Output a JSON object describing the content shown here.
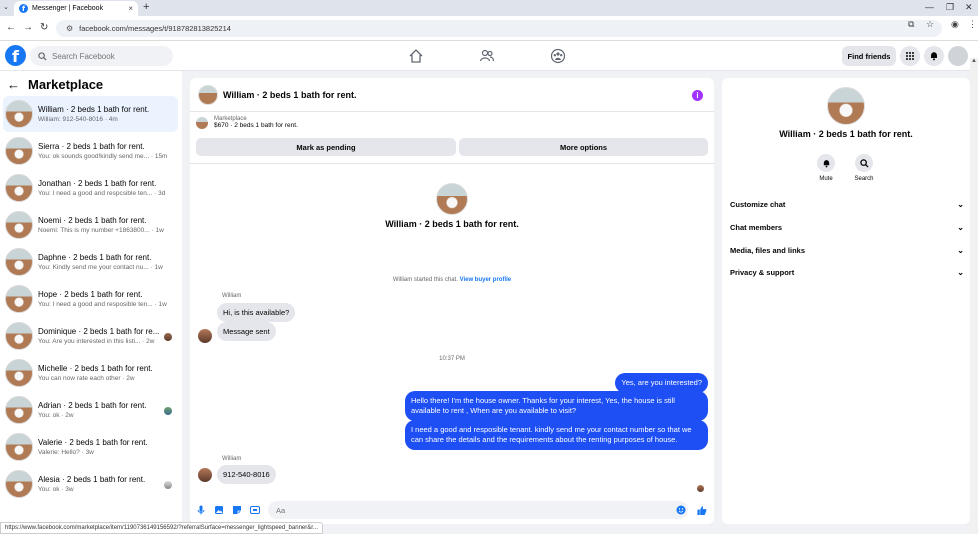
{
  "browser": {
    "tab_title": "Messenger | Facebook",
    "url": "facebook.com/messages/t/918782813825214",
    "status_url": "https://www.facebook.com/marketplace/item/1190736149156592/?referralSurface=messenger_lightspeed_banner&r..."
  },
  "fbnav": {
    "search_placeholder": "Search Facebook",
    "find_friends": "Find friends"
  },
  "sidebar": {
    "title": "Marketplace",
    "conversations": [
      {
        "name": "William · 2 beds 1 bath for rent.",
        "preview": "William: 912-540-8016 · 4m"
      },
      {
        "name": "Sierra · 2 beds 1 bath for rent.",
        "preview": "You: ok sounds good!kindly send me... · 15m"
      },
      {
        "name": "Jonathan · 2 beds 1 bath for rent.",
        "preview": "You: I need a good and respcsible ten... · 3d"
      },
      {
        "name": "Noemi · 2 beds 1 bath for rent.",
        "preview": "Noemi: This is my number +1863800... · 1w"
      },
      {
        "name": "Daphne · 2 beds 1 bath for rent.",
        "preview": "You: Kindly send me your contact nu... · 1w"
      },
      {
        "name": "Hope · 2 beds 1 bath for rent.",
        "preview": "You: I need a good and resposible ten... · 1w"
      },
      {
        "name": "Dominique · 2 beds 1 bath for re...",
        "preview": "You: Are you interested in this listi... · 2w"
      },
      {
        "name": "Michelle · 2 beds 1 bath for rent.",
        "preview": "You can now rate each other · 2w"
      },
      {
        "name": "Adrian · 2 beds 1 bath for rent.",
        "preview": "You: ok · 2w"
      },
      {
        "name": "Valerie · 2 beds 1 bath for rent.",
        "preview": "Valerie: Hello? · 3w"
      },
      {
        "name": "Alesia · 2 beds 1 bath for rent.",
        "preview": "You: ok · 3w"
      }
    ]
  },
  "chat": {
    "header_name": "William · 2 beds 1 bath for rent.",
    "listing_source": "Marketplace",
    "listing_price": "$670 · 2 beds 1 bath for rent.",
    "mark_pending": "Mark as pending",
    "more_options": "More options",
    "intro_name": "William · 2 beds 1 bath for rent.",
    "started_text": "William started this chat.",
    "view_profile": "View buyer profile",
    "sender_1": "William",
    "msg_in_1": "Hi, is this available?",
    "msg_in_2": "Message sent",
    "time": "10:37 PM",
    "msg_out_1": "Yes, are you interested?",
    "msg_out_2": "Hello there! I'm the house owner. Thanks for your interest, Yes, the house is still available to rent , When are you available to visit?",
    "msg_out_3": "I need a good and resposible tenant.  kindly send me your contact number so that we can share the details and the requirements about the renting purposes of house.",
    "sender_2": "William",
    "msg_in_3": "912-540-8016",
    "composer_placeholder": "Aa"
  },
  "rpanel": {
    "name": "William · 2 beds 1 bath for rent.",
    "mute": "Mute",
    "search": "Search",
    "sections": [
      "Customize chat",
      "Chat members",
      "Media, files and links",
      "Privacy & support"
    ]
  },
  "colors": {
    "brand": "#1877f2",
    "outgoing_bubble": "#1d4ff5",
    "info_icon": "#a033ff"
  }
}
